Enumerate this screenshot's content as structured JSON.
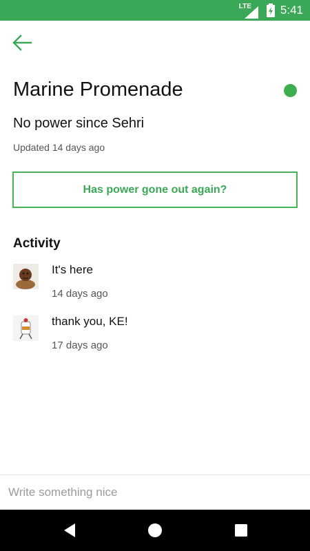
{
  "status_bar": {
    "network": "LTE",
    "time": "5:41"
  },
  "place": {
    "title": "Marine Promenade",
    "status_color": "#3fae4e",
    "description": "No power since Sehri",
    "updated": "Updated 14 days ago"
  },
  "outage_button": {
    "label": "Has power gone out again?"
  },
  "activity": {
    "heading": "Activity",
    "items": [
      {
        "message": "It's here",
        "time": "14 days ago"
      },
      {
        "message": "thank you, KE!",
        "time": "17 days ago"
      }
    ]
  },
  "composer": {
    "placeholder": "Write something nice",
    "value": ""
  },
  "colors": {
    "accent": "#3aa856",
    "status_bar": "#3aa856"
  },
  "icons": {
    "back": "arrow-left-icon",
    "lte": "lte-signal-icon",
    "battery": "battery-charging-icon",
    "nav_back": "triangle-back-icon",
    "nav_home": "circle-home-icon",
    "nav_recents": "square-recents-icon"
  }
}
